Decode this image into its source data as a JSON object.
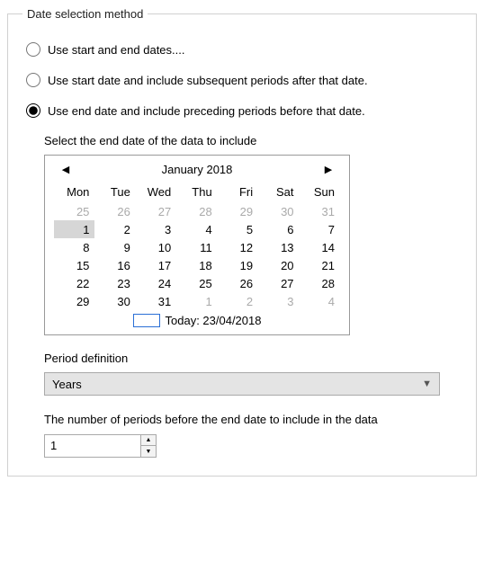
{
  "legend": "Date selection method",
  "radios": {
    "opt1": "Use start and end dates....",
    "opt2": "Use start date and include subsequent periods after that date.",
    "opt3": "Use end date and include preceding periods before that date."
  },
  "selectEndLabel": "Select the end date of the data to include",
  "calendar": {
    "title": "January 2018",
    "dayHeaders": [
      "Mon",
      "Tue",
      "Wed",
      "Thu",
      "Fri",
      "Sat",
      "Sun"
    ],
    "weeks": [
      [
        {
          "d": "25",
          "o": true
        },
        {
          "d": "26",
          "o": true
        },
        {
          "d": "27",
          "o": true
        },
        {
          "d": "28",
          "o": true
        },
        {
          "d": "29",
          "o": true
        },
        {
          "d": "30",
          "o": true
        },
        {
          "d": "31",
          "o": true
        }
      ],
      [
        {
          "d": "1",
          "sel": true
        },
        {
          "d": "2"
        },
        {
          "d": "3"
        },
        {
          "d": "4"
        },
        {
          "d": "5"
        },
        {
          "d": "6"
        },
        {
          "d": "7"
        }
      ],
      [
        {
          "d": "8"
        },
        {
          "d": "9"
        },
        {
          "d": "10"
        },
        {
          "d": "11"
        },
        {
          "d": "12"
        },
        {
          "d": "13"
        },
        {
          "d": "14"
        }
      ],
      [
        {
          "d": "15"
        },
        {
          "d": "16"
        },
        {
          "d": "17"
        },
        {
          "d": "18"
        },
        {
          "d": "19"
        },
        {
          "d": "20"
        },
        {
          "d": "21"
        }
      ],
      [
        {
          "d": "22"
        },
        {
          "d": "23"
        },
        {
          "d": "24"
        },
        {
          "d": "25"
        },
        {
          "d": "26"
        },
        {
          "d": "27"
        },
        {
          "d": "28"
        }
      ],
      [
        {
          "d": "29"
        },
        {
          "d": "30"
        },
        {
          "d": "31"
        },
        {
          "d": "1",
          "o": true
        },
        {
          "d": "2",
          "o": true
        },
        {
          "d": "3",
          "o": true
        },
        {
          "d": "4",
          "o": true
        }
      ]
    ],
    "todayLabel": "Today: 23/04/2018"
  },
  "periodDefLabel": "Period definition",
  "periodDefValue": "Years",
  "numPeriodsLabel": "The number of periods before the end date to include in the data",
  "numPeriodsValue": "1"
}
